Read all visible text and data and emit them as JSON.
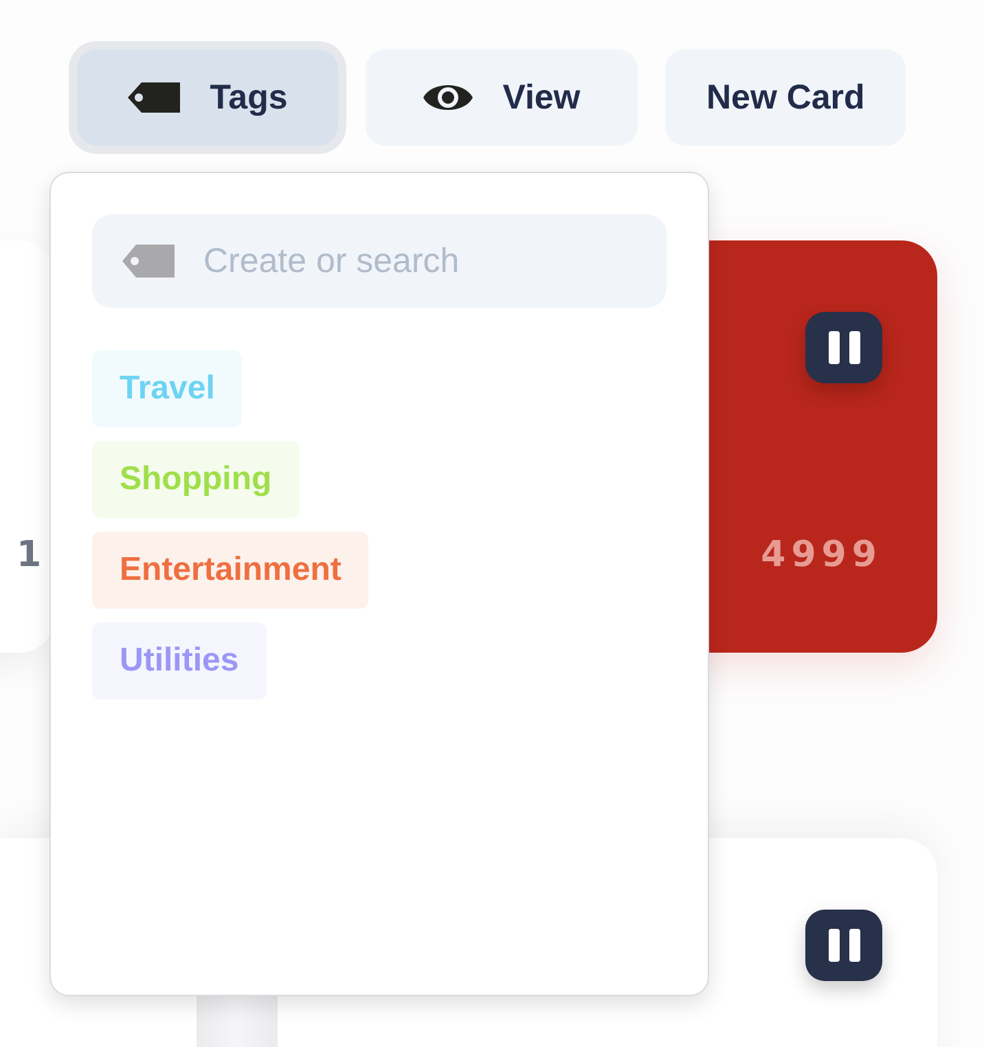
{
  "toolbar": [
    {
      "label": "Tags",
      "kind": "tag",
      "selected": true
    },
    {
      "label": "View",
      "kind": "eye",
      "selected": false
    },
    {
      "label": "New Card",
      "kind": "plain",
      "selected": false
    }
  ],
  "cards": [
    {
      "color": "#ffffff",
      "number": "1"
    },
    {
      "color": "#b9261b",
      "number": "4999",
      "paused": true
    },
    {
      "color": "#ffffff",
      "paused": true
    }
  ],
  "tag_menu": {
    "search": {
      "placeholder": "Create or search"
    },
    "tags": [
      {
        "label": "Travel",
        "color": "#6fd3f2"
      },
      {
        "label": "Shopping",
        "color": "#9fdf4b"
      },
      {
        "label": "Entertainment",
        "color": "#ee6f40"
      },
      {
        "label": "Utilities",
        "color": "#9b97f5"
      }
    ]
  }
}
